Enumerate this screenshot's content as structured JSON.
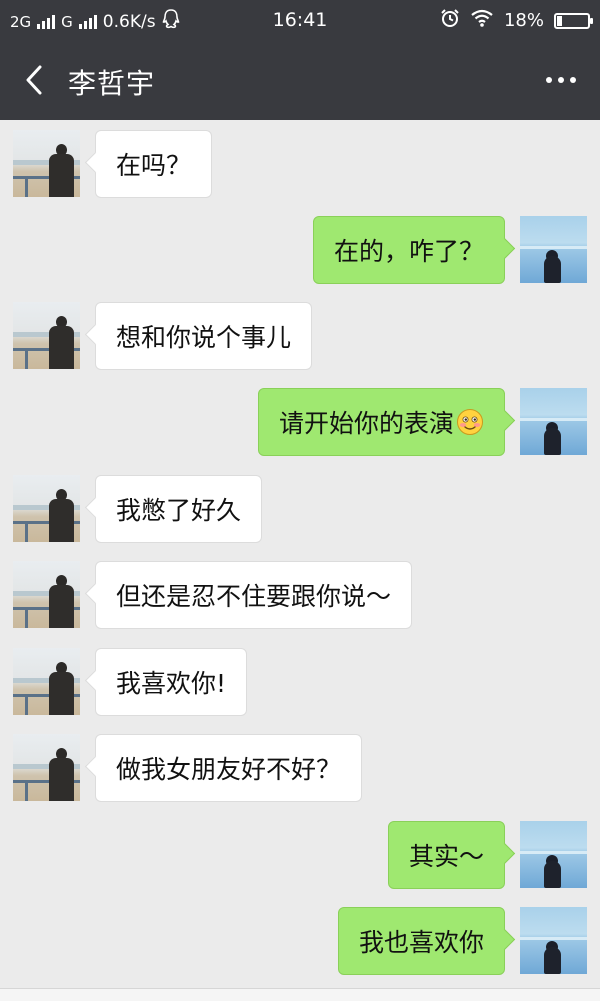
{
  "status_bar": {
    "network_1": "2G",
    "network_2": "G",
    "speed": "0.6K/s",
    "time": "16:41",
    "battery_percent": "18%",
    "battery_level": 0.18
  },
  "header": {
    "title": "李哲宇"
  },
  "messages": [
    {
      "side": "in",
      "text": "在吗？"
    },
    {
      "side": "out",
      "text": "在的，咋了？"
    },
    {
      "side": "in",
      "text": "想和你说个事儿"
    },
    {
      "side": "out",
      "text": "请开始你的表演",
      "emoji": "blushing-smile-emoji"
    },
    {
      "side": "in",
      "text": "我憋了好久"
    },
    {
      "side": "in",
      "text": "但还是忍不住要跟你说～"
    },
    {
      "side": "in",
      "text": "我喜欢你!"
    },
    {
      "side": "in",
      "text": "做我女朋友好不好？"
    },
    {
      "side": "out",
      "text": "其实～"
    },
    {
      "side": "out",
      "text": "我也喜欢你"
    }
  ],
  "colors": {
    "header_bg": "#393a3f",
    "chat_bg": "#ebebeb",
    "outgoing_bubble": "#9fe870",
    "incoming_bubble": "#ffffff"
  }
}
